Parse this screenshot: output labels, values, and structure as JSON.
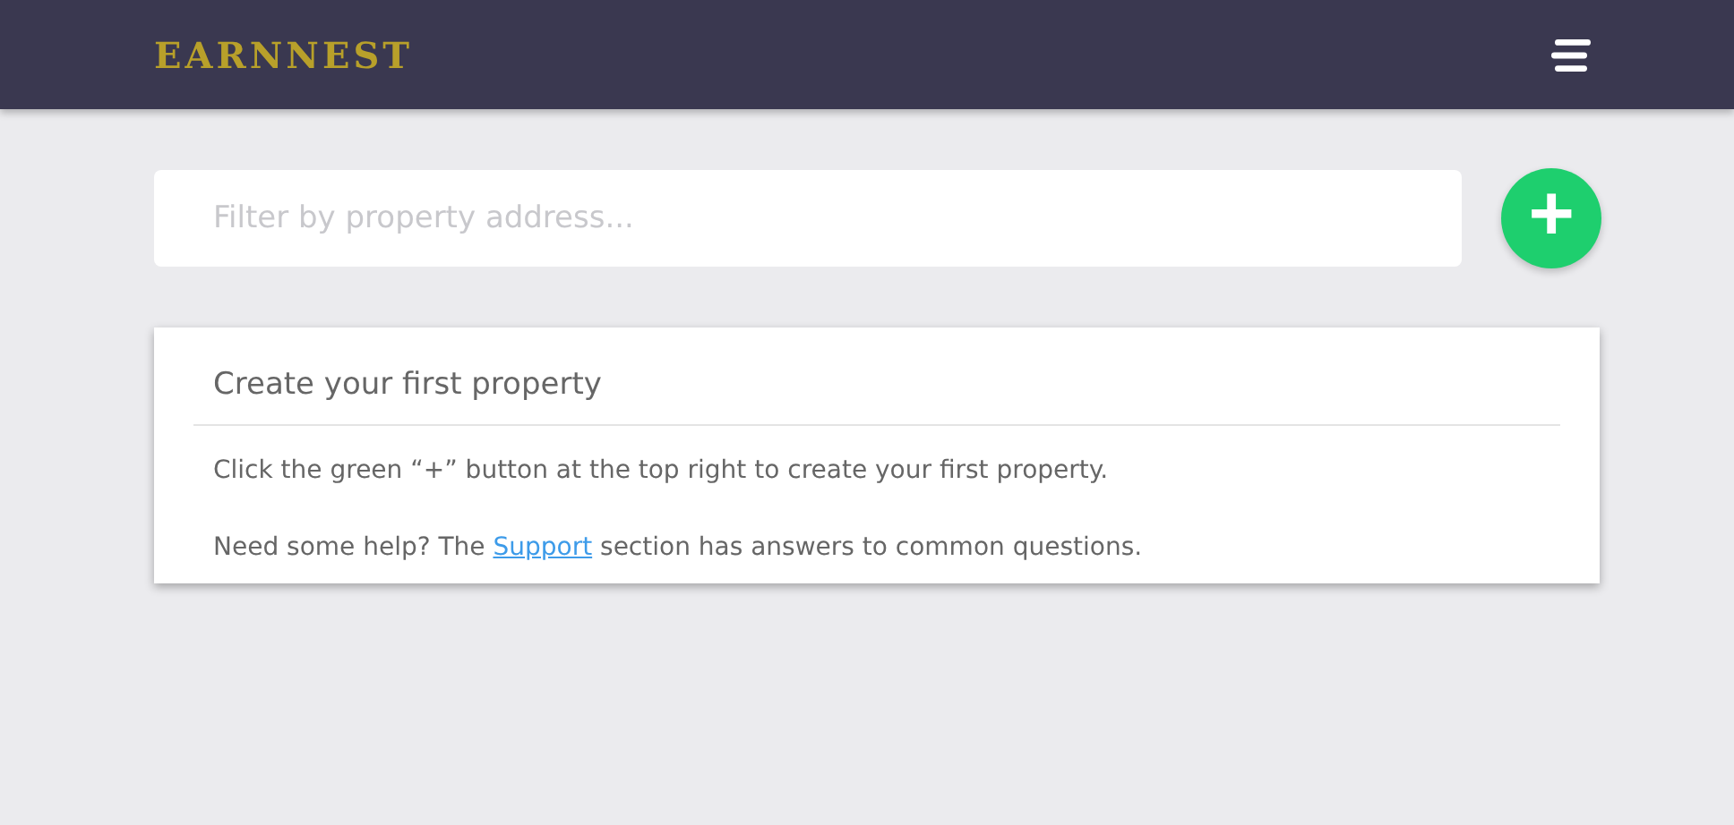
{
  "header": {
    "brand": "EARNNEST"
  },
  "filter": {
    "placeholder": "Filter by property address..."
  },
  "add_button": {
    "label": "+"
  },
  "card": {
    "title": "Create your first property",
    "paragraphs": [
      {
        "before": "Click the green “+” button at the top right to create your first property."
      },
      {
        "before": "Need some help? The ",
        "link": "Support",
        "after": " section has answers to common questions."
      }
    ]
  }
}
